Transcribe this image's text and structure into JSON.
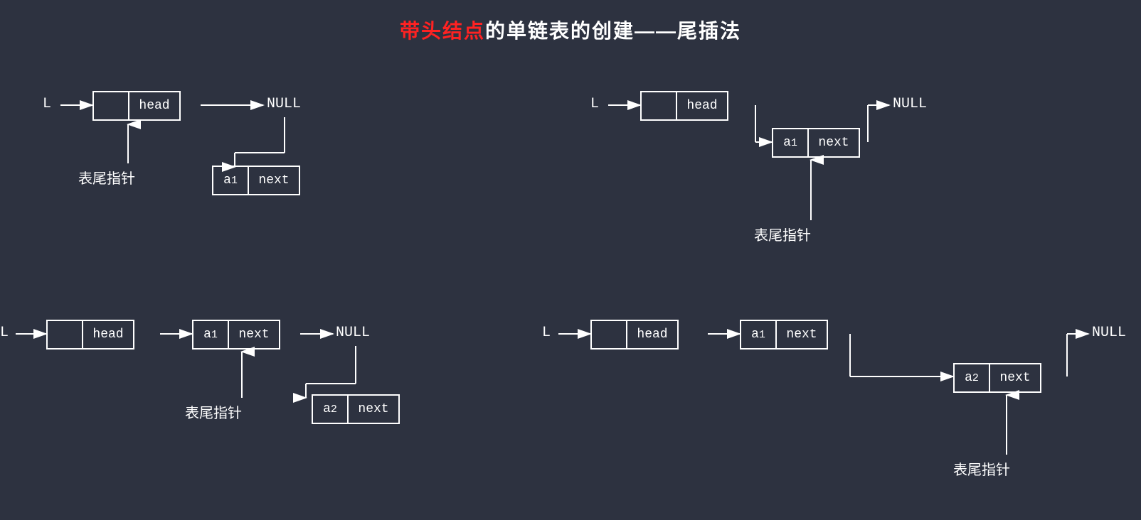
{
  "title": {
    "prefix": "带头结点",
    "suffix": "的单链表的创建——尾插法",
    "highlight": "带头结点"
  },
  "diagrams": {
    "top_left": {
      "L_label": "L",
      "head_label": "head",
      "null_label": "NULL",
      "tail_label": "表尾指针",
      "a1_label": "a₁",
      "next_label": "next"
    },
    "top_right": {
      "L_label": "L",
      "head_label": "head",
      "null_label": "NULL",
      "tail_label": "表尾指针",
      "a1_label": "a₁",
      "next_label": "next"
    },
    "bottom_left": {
      "L_label": "L",
      "head_label": "head",
      "a1_label": "a₁",
      "next_label": "next",
      "null_label": "NULL",
      "tail_label": "表尾指针",
      "a2_label": "a₂",
      "next2_label": "next"
    },
    "bottom_right": {
      "L_label": "L",
      "head_label": "head",
      "a1_label": "a₁",
      "next_label": "next",
      "null_label": "NULL",
      "tail_label": "表尾指针",
      "a2_label": "a₂",
      "next2_label": "next"
    }
  }
}
